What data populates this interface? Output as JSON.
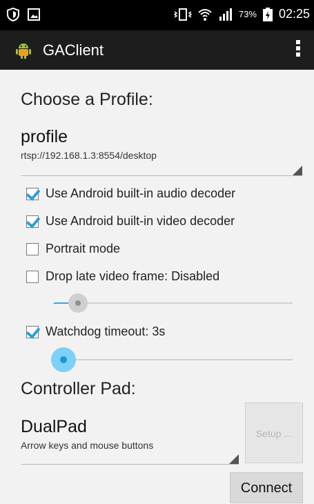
{
  "status_bar": {
    "battery_percent": "73%",
    "time": "02:25",
    "icons": [
      "shield-icon",
      "image-icon",
      "vibrate-icon",
      "wifi-icon",
      "signal-icon",
      "battery-icon"
    ]
  },
  "action_bar": {
    "title": "GAClient",
    "icons": [
      "android-icon",
      "overflow-menu-icon"
    ]
  },
  "profile_section": {
    "heading": "Choose a Profile:",
    "selected_name": "profile",
    "selected_url": "rtsp://192.168.1.3:8554/desktop"
  },
  "options": {
    "audio_decoder": {
      "label": "Use Android built-in audio decoder",
      "checked": true
    },
    "video_decoder": {
      "label": "Use Android built-in video decoder",
      "checked": true
    },
    "portrait_mode": {
      "label": "Portrait mode",
      "checked": false
    },
    "drop_late": {
      "label": "Drop late video frame: Disabled",
      "checked": false,
      "slider_value": 0.1
    },
    "watchdog": {
      "label": "Watchdog timeout: 3s",
      "checked": true,
      "slider_value": 0.04
    }
  },
  "controller_section": {
    "heading": "Controller Pad:",
    "selected_name": "DualPad",
    "selected_desc": "Arrow keys and mouse buttons",
    "setup_label": "Setup ..."
  },
  "connect_label": "Connect",
  "colors": {
    "accent": "#2e9ed6",
    "action_bar": "#1d1d1d",
    "background": "#f2f2f2"
  }
}
